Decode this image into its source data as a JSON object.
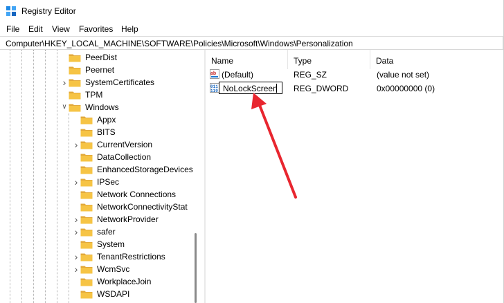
{
  "window": {
    "title": "Registry Editor"
  },
  "menu": [
    "File",
    "Edit",
    "View",
    "Favorites",
    "Help"
  ],
  "address": "Computer\\HKEY_LOCAL_MACHINE\\SOFTWARE\\Policies\\Microsoft\\Windows\\Personalization",
  "tree": [
    {
      "label": "PeerDist",
      "expandable": false
    },
    {
      "label": "Peernet",
      "expandable": false
    },
    {
      "label": "SystemCertificates",
      "expandable": true
    },
    {
      "label": "TPM",
      "expandable": false
    },
    {
      "label": "Windows",
      "expanded": true
    },
    {
      "label": "Appx",
      "expandable": false
    },
    {
      "label": "BITS",
      "expandable": false
    },
    {
      "label": "CurrentVersion",
      "expandable": true
    },
    {
      "label": "DataCollection",
      "expandable": false
    },
    {
      "label": "EnhancedStorageDevices",
      "expandable": false
    },
    {
      "label": "IPSec",
      "expandable": true
    },
    {
      "label": "Network Connections",
      "expandable": false
    },
    {
      "label": "NetworkConnectivityStat",
      "expandable": false
    },
    {
      "label": "NetworkProvider",
      "expandable": true
    },
    {
      "label": "safer",
      "expandable": true
    },
    {
      "label": "System",
      "expandable": false
    },
    {
      "label": "TenantRestrictions",
      "expandable": true
    },
    {
      "label": "WcmSvc",
      "expandable": true
    },
    {
      "label": "WorkplaceJoin",
      "expandable": false
    },
    {
      "label": "WSDAPI",
      "expandable": false
    }
  ],
  "columns": {
    "name": "Name",
    "type": "Type",
    "data": "Data"
  },
  "values": [
    {
      "name": "(Default)",
      "type": "REG_SZ",
      "data": "(value not set)",
      "icon": "string-value-icon"
    },
    {
      "name": "",
      "type": "REG_DWORD",
      "data": "0x00000000 (0)",
      "icon": "dword-value-icon"
    }
  ],
  "rename": {
    "text": "NoLockScreen"
  },
  "colors": {
    "folder": "#f6c445",
    "arrow": "#e8262f"
  }
}
